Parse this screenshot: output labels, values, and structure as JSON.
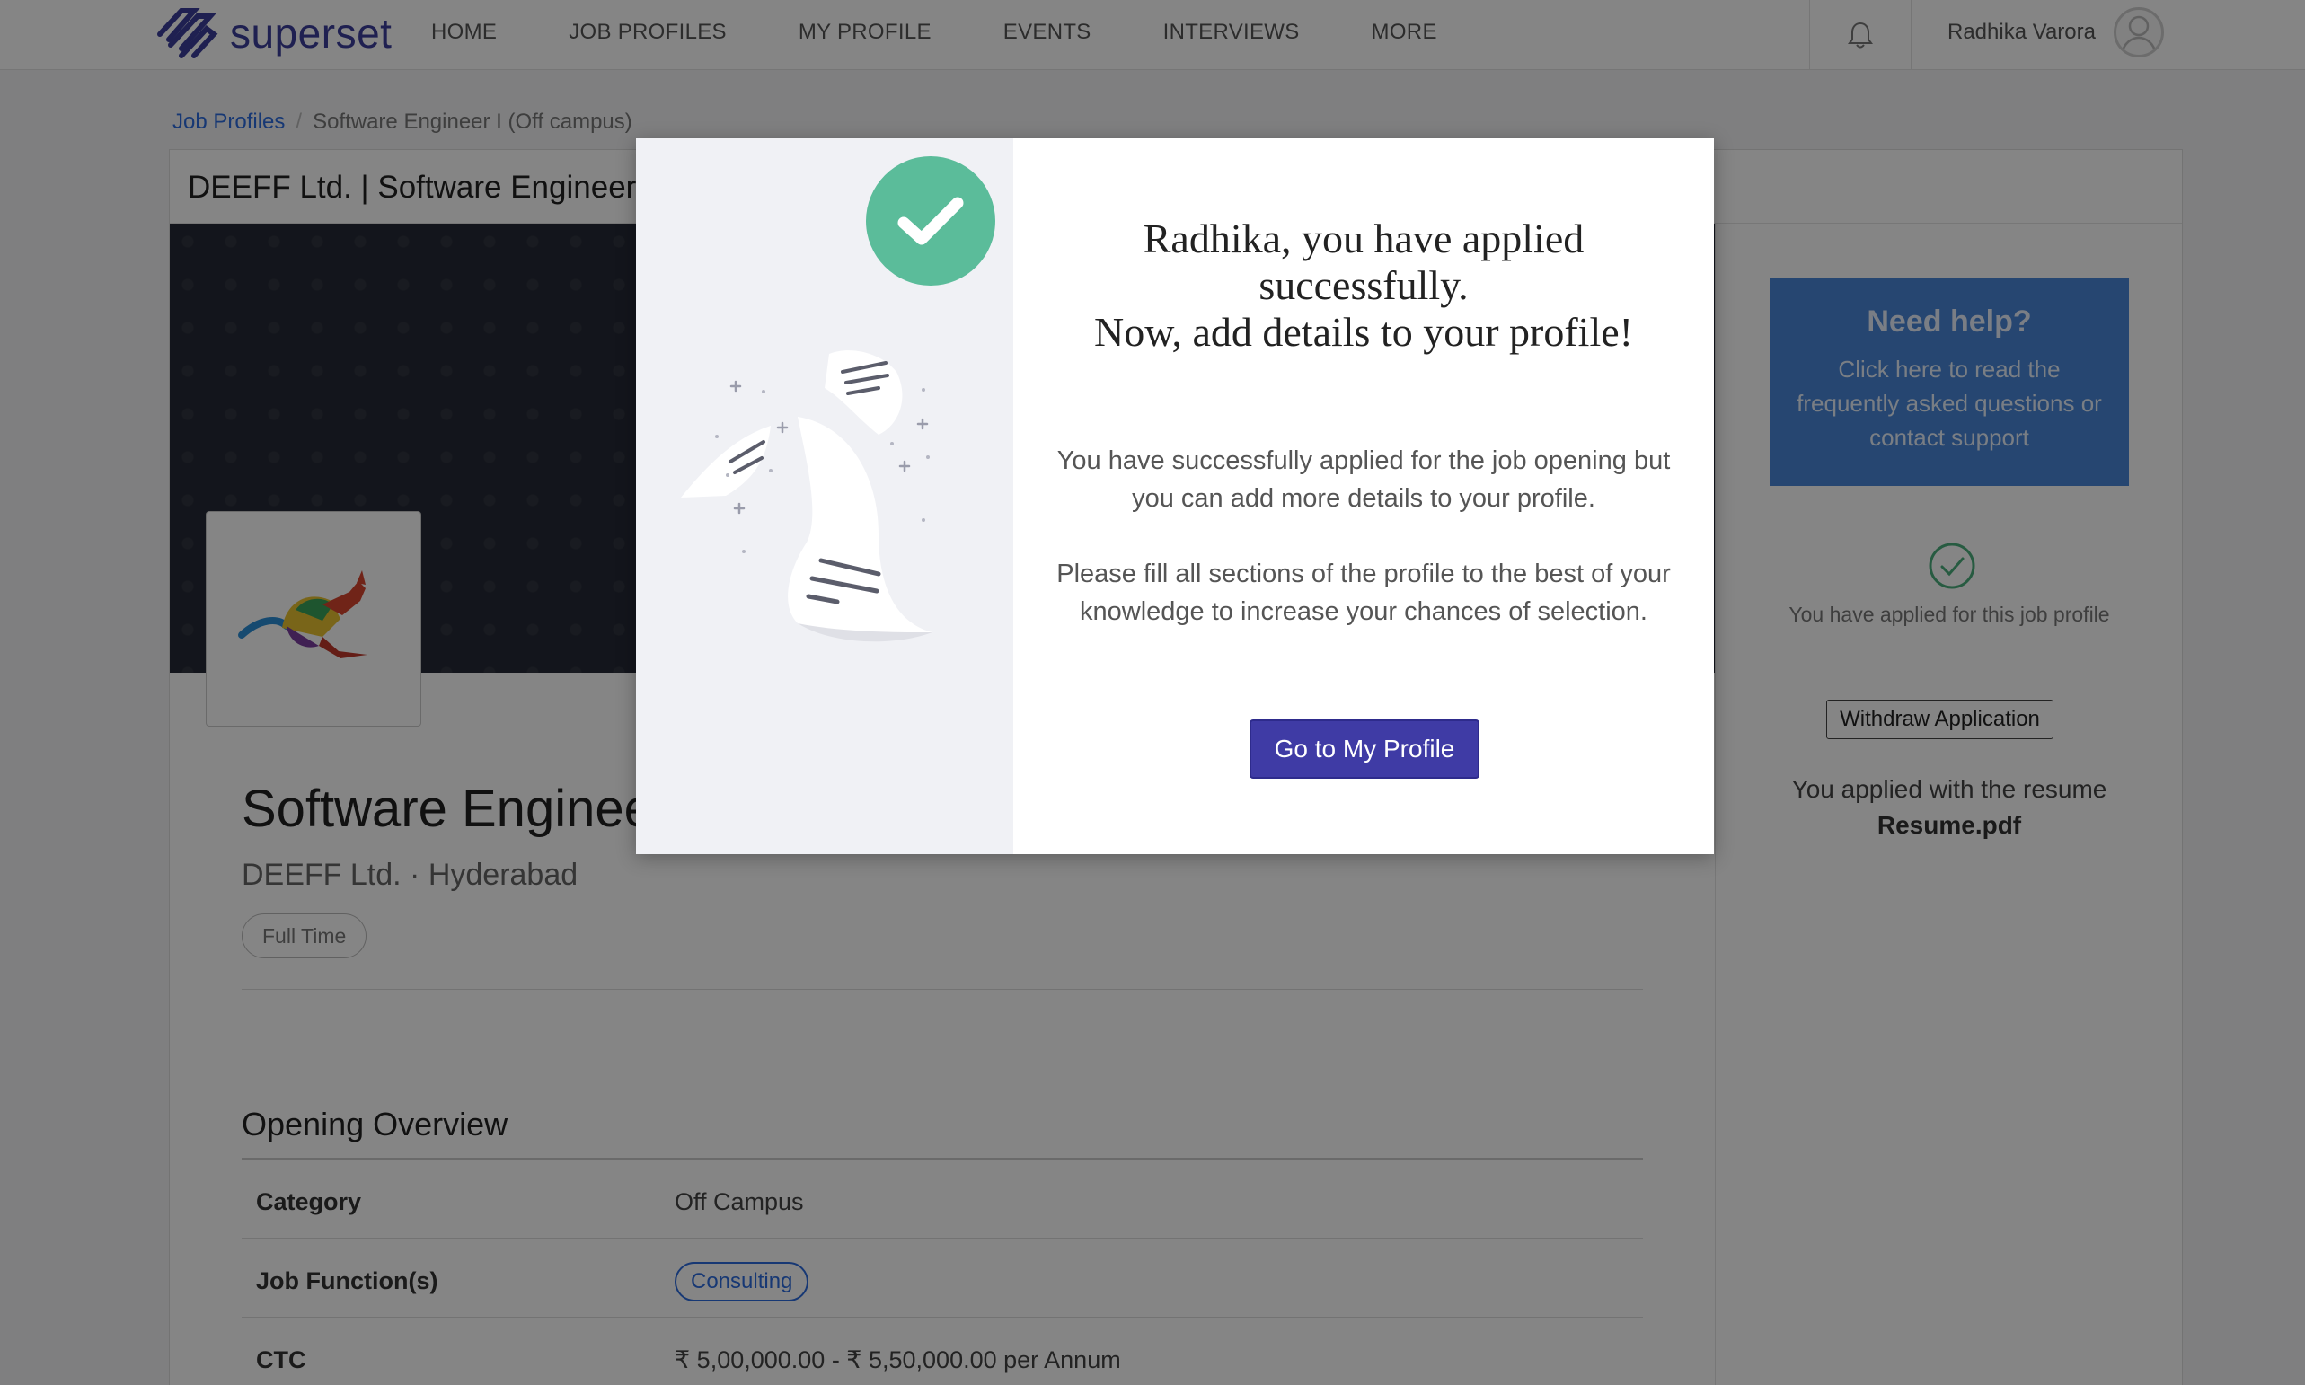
{
  "app": {
    "logo_text": "superset"
  },
  "nav": {
    "items": [
      "HOME",
      "JOB PROFILES",
      "MY PROFILE",
      "EVENTS",
      "INTERVIEWS",
      "MORE"
    ],
    "user_name": "Radhika Varora"
  },
  "breadcrumb": {
    "parent": "Job Profiles",
    "current": "Software Engineer I (Off campus)"
  },
  "job": {
    "header_title": "DEEFF Ltd. | Software Engineer",
    "title": "Software Engineer",
    "company_location": "DEEFF Ltd. · Hyderabad",
    "type": "Full Time",
    "overview_title": "Opening Overview",
    "details": {
      "category_label": "Category",
      "category_value": "Off Campus",
      "function_label": "Job Function(s)",
      "function_value": "Consulting",
      "ctc_label": "CTC",
      "ctc_value": "₹ 5,00,000.00 - ₹ 5,50,000.00 per Annum"
    }
  },
  "sidebar": {
    "help_title": "Need help?",
    "help_text": "Click here to read the frequently asked questions or contact support",
    "applied_text": "You have applied for this job profile",
    "withdraw_label": "Withdraw Application",
    "resume_text": "You applied with the resume",
    "resume_file": "Resume.pdf"
  },
  "modal": {
    "heading_line1": "Radhika, you have applied successfully.",
    "heading_line2": "Now, add details to your profile!",
    "paragraph1": "You have successfully applied for the job opening but you can add more details to your profile.",
    "paragraph2": "Please fill all sections of the profile to the best of your knowledge to increase your chances of selection.",
    "button_label": "Go to My Profile"
  },
  "colors": {
    "brand": "#3c3f9b",
    "link": "#2d6cdf",
    "success": "#5bbc9a",
    "help_box": "#4a86d8",
    "primary_button": "#3f3ba5"
  },
  "icons": [
    "superset-logo-icon",
    "bell-icon",
    "user-avatar-icon",
    "check-icon",
    "check-circle-icon",
    "kangaroo-logo"
  ]
}
